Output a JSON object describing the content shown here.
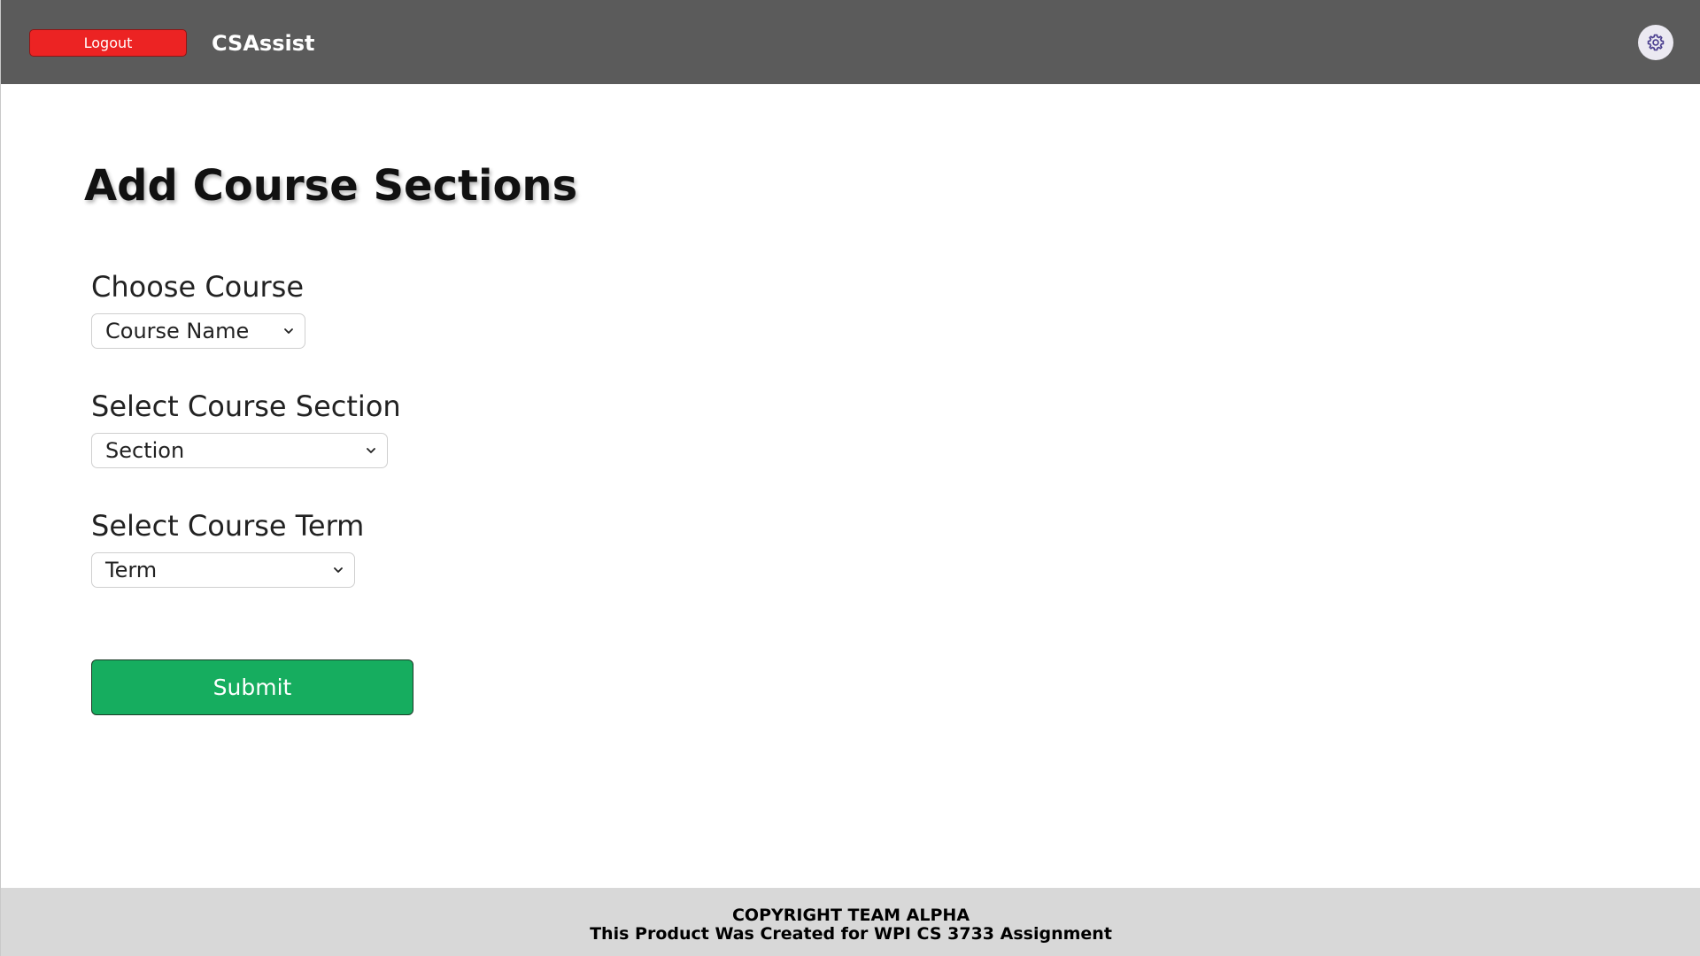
{
  "header": {
    "logout_label": "Logout",
    "app_title": "CSAssist",
    "settings_icon": "gear-icon",
    "background_color": "#5b5b5b",
    "logout_color": "#ec2323"
  },
  "main": {
    "page_title": "Add Course Sections",
    "course": {
      "label": "Choose Course",
      "selected": "Course Name"
    },
    "section": {
      "label": "Select Course Section",
      "selected": "Section"
    },
    "term": {
      "label": "Select Course Term",
      "selected": "Term"
    },
    "submit_label": "Submit",
    "submit_color": "#16ad5f"
  },
  "footer": {
    "line1": "COPYRIGHT TEAM ALPHA",
    "line2": "This Product Was Created for WPI CS 3733 Assignment",
    "background_color": "#d8d8d8"
  }
}
